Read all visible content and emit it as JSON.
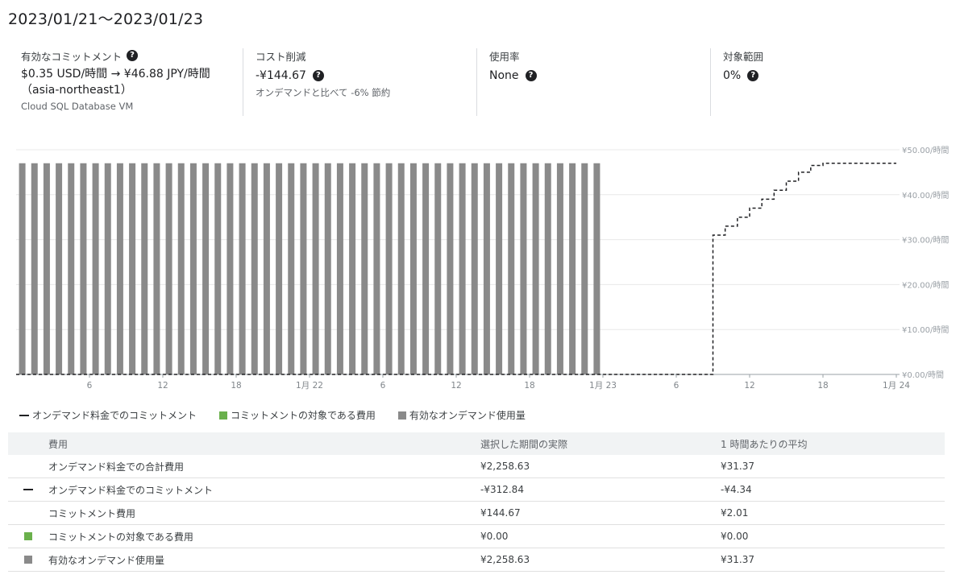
{
  "header": {
    "date_range": "2023/01/21〜2023/01/23"
  },
  "summary": {
    "commitment": {
      "label": "有効なコミットメント",
      "value": "$0.35 USD/時間 → ¥46.88 JPY/時間",
      "value2": "（asia-northeast1）",
      "sub": "Cloud SQL Database VM"
    },
    "savings": {
      "label": "コスト削減",
      "value": "-¥144.67",
      "sub": "オンデマンドと比べて -6% 節約"
    },
    "utilization": {
      "label": "使用率",
      "value": "None"
    },
    "coverage": {
      "label": "対象範囲",
      "value": "0%"
    }
  },
  "colors": {
    "bar": "#8a8a8a",
    "covered": "#6ab04c",
    "line": "#202124",
    "grid": "#e8e8e8"
  },
  "chart_data": {
    "type": "bar",
    "y_tick_labels": [
      "¥0.00/時間",
      "¥10.00/時間",
      "¥20.00/時間",
      "¥30.00/時間",
      "¥40.00/時間",
      "¥50.00/時間"
    ],
    "ylim": [
      0,
      50
    ],
    "x_ticks": [
      {
        "hour": 6,
        "label": "6"
      },
      {
        "hour": 12,
        "label": "12"
      },
      {
        "hour": 18,
        "label": "18"
      },
      {
        "hour": 24,
        "label": "1月 22"
      },
      {
        "hour": 30,
        "label": "6"
      },
      {
        "hour": 36,
        "label": "12"
      },
      {
        "hour": 42,
        "label": "18"
      },
      {
        "hour": 48,
        "label": "1月 23"
      },
      {
        "hour": 54,
        "label": "6"
      },
      {
        "hour": 60,
        "label": "12"
      },
      {
        "hour": 66,
        "label": "18"
      },
      {
        "hour": 72,
        "label": "1月 24"
      }
    ],
    "xlim_hours": [
      0,
      72
    ],
    "series": [
      {
        "name": "有効なオンデマンド使用量",
        "type": "bar",
        "values": [
          47,
          47,
          47,
          47,
          47,
          47,
          47,
          47,
          47,
          47,
          47,
          47,
          47,
          47,
          47,
          47,
          47,
          47,
          47,
          47,
          47,
          47,
          47,
          47,
          47,
          47,
          47,
          47,
          47,
          47,
          47,
          47,
          47,
          47,
          47,
          47,
          47,
          47,
          47,
          47,
          47,
          47,
          47,
          47,
          47,
          47,
          47,
          47
        ]
      },
      {
        "name": "オンデマンド料金でのコミットメント",
        "type": "step-line",
        "points": [
          [
            0,
            0
          ],
          [
            57,
            0
          ],
          [
            57,
            31
          ],
          [
            58,
            31
          ],
          [
            58,
            33
          ],
          [
            59,
            33
          ],
          [
            59,
            35
          ],
          [
            60,
            35
          ],
          [
            60,
            37
          ],
          [
            61,
            37
          ],
          [
            61,
            39
          ],
          [
            62,
            39
          ],
          [
            62,
            41
          ],
          [
            63,
            41
          ],
          [
            63,
            43
          ],
          [
            64,
            43
          ],
          [
            64,
            45
          ],
          [
            65,
            45
          ],
          [
            65,
            46.5
          ],
          [
            66,
            46.5
          ],
          [
            66,
            47
          ],
          [
            72,
            47
          ]
        ]
      }
    ]
  },
  "legend": [
    {
      "label": "オンデマンド料金でのコミットメント",
      "kind": "dash"
    },
    {
      "label": "コミットメントの対象である費用",
      "kind": "green"
    },
    {
      "label": "有効なオンデマンド使用量",
      "kind": "gray"
    }
  ],
  "table": {
    "headers": [
      "費用",
      "選択した期間の実際",
      "1 時間あたりの平均"
    ],
    "rows": [
      {
        "marker": "",
        "name": "オンデマンド料金での合計費用",
        "actual": "¥2,258.63",
        "avg": "¥31.37"
      },
      {
        "marker": "dash",
        "name": "オンデマンド料金でのコミットメント",
        "actual": "-¥312.84",
        "avg": "-¥4.34"
      },
      {
        "marker": "",
        "name": "コミットメント費用",
        "actual": "¥144.67",
        "avg": "¥2.01"
      },
      {
        "marker": "green",
        "name": "コミットメントの対象である費用",
        "actual": "¥0.00",
        "avg": "¥0.00"
      },
      {
        "marker": "gray",
        "name": "有効なオンデマンド使用量",
        "actual": "¥2,258.63",
        "avg": "¥31.37"
      }
    ]
  }
}
